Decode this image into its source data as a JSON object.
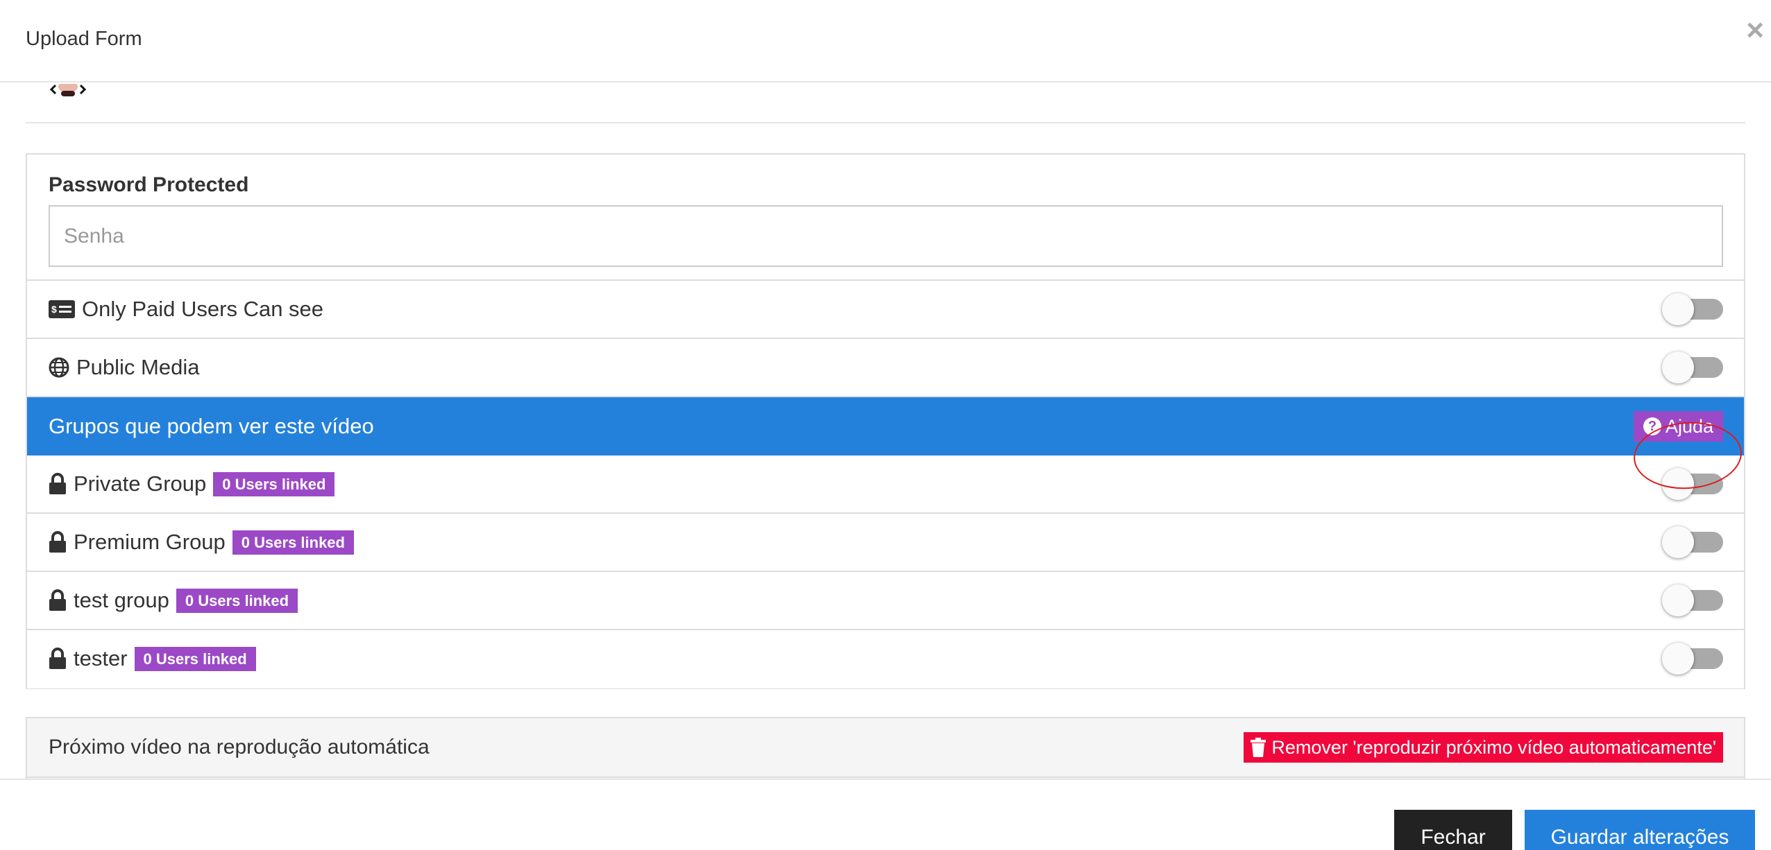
{
  "modal": {
    "title": "Upload Form",
    "close_icon": "close-icon"
  },
  "password": {
    "label": "Password Protected",
    "placeholder": "Senha",
    "value": ""
  },
  "paid_only": {
    "icon": "money-card-icon",
    "label": "Only Paid Users Can see",
    "enabled": false
  },
  "public_media": {
    "icon": "globe-icon",
    "label": "Public Media",
    "enabled": false
  },
  "groups": {
    "header": "Grupos que podem ver este vídeo",
    "help_label": "Ajuda",
    "items": [
      {
        "icon": "lock-icon",
        "name": "Private Group",
        "badge": "0 Users linked",
        "enabled": false
      },
      {
        "icon": "lock-icon",
        "name": "Premium Group",
        "badge": "0 Users linked",
        "enabled": false
      },
      {
        "icon": "lock-icon",
        "name": "test group",
        "badge": "0 Users linked",
        "enabled": false
      },
      {
        "icon": "lock-icon",
        "name": "tester",
        "badge": "0 Users linked",
        "enabled": false
      }
    ]
  },
  "autoplay": {
    "title": "Próximo vídeo na reprodução automática",
    "remove_label": "Remover 'reproduzir próximo vídeo automaticamente'"
  },
  "footer": {
    "close_label": "Fechar",
    "save_label": "Guardar alterações"
  },
  "colors": {
    "primary": "#2481db",
    "badge": "#9b49c6",
    "danger": "#f0083c",
    "dark_button": "#222222",
    "annotation": "#e01b1b"
  }
}
